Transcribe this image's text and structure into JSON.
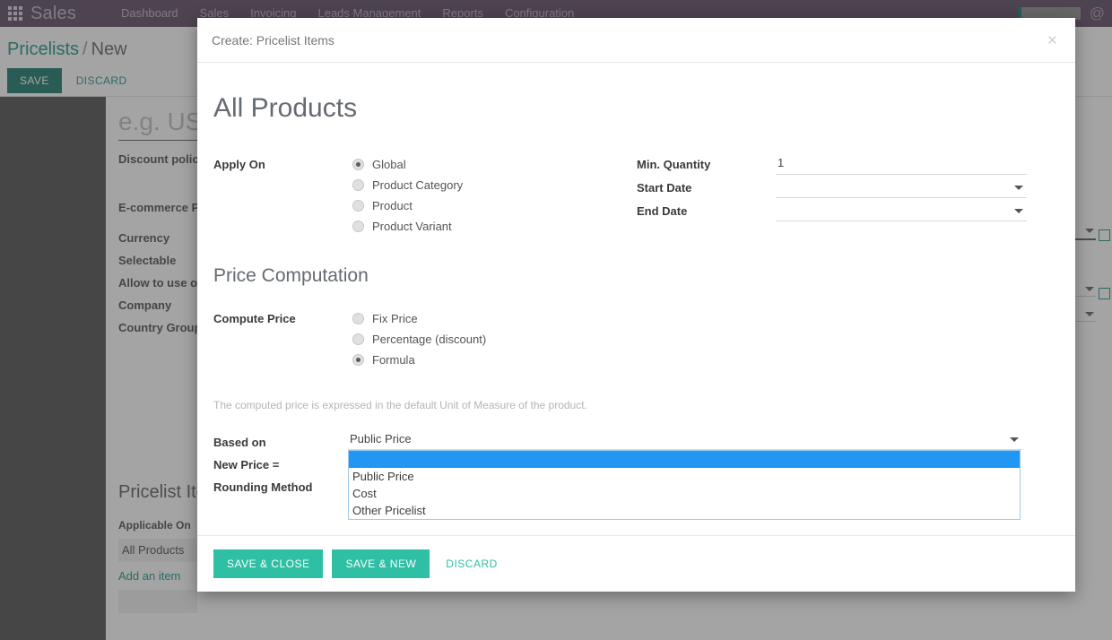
{
  "navbar": {
    "apps_icon": "apps-grid-icon",
    "brand": "Sales",
    "links": [
      "Dashboard",
      "Sales",
      "Invoicing",
      "Leads Management",
      "Reports",
      "Configuration"
    ],
    "messaging_icon": "at-sign-icon"
  },
  "background": {
    "breadcrumb": {
      "root": "Pricelists",
      "separator": "/",
      "current": "New"
    },
    "save_label": "SAVE",
    "discard_label": "DISCARD",
    "title_placeholder": "e.g. USD Retailers",
    "labels": {
      "discount_policy": "Discount policy",
      "ecommerce": "E-commerce Promotional Code",
      "currency": "Currency",
      "selectable": "Selectable",
      "allow_use_on": "Allow to use on",
      "company": "Company",
      "country_groups": "Country Groups"
    },
    "sublist": {
      "title": "Pricelist Items",
      "column_header": "Applicable On",
      "row_value": "All Products",
      "add_link": "Add an item"
    }
  },
  "modal": {
    "header_title": "Create: Pricelist Items",
    "close_icon": "close-icon",
    "record_title": "All Products",
    "apply_on": {
      "label": "Apply On",
      "options": [
        "Global",
        "Product Category",
        "Product",
        "Product Variant"
      ],
      "selected": "Global"
    },
    "min_quantity": {
      "label": "Min. Quantity",
      "value": "1"
    },
    "start_date": {
      "label": "Start Date",
      "value": ""
    },
    "end_date": {
      "label": "End Date",
      "value": ""
    },
    "price_computation": {
      "section_title": "Price Computation",
      "compute_price_label": "Compute Price",
      "options": [
        "Fix Price",
        "Percentage (discount)",
        "Formula"
      ],
      "selected": "Formula",
      "help_note": "The computed price is expressed in the default Unit of Measure of the product."
    },
    "based_on": {
      "label": "Based on",
      "value": "Public Price",
      "options": [
        "",
        "Public Price",
        "Cost",
        "Other Pricelist"
      ],
      "highlighted_option": ""
    },
    "new_price_label": "New Price =",
    "rounding_method_label": "Rounding Method",
    "footer": {
      "save_close": "SAVE & CLOSE",
      "save_new": "SAVE & NEW",
      "discard": "DISCARD"
    }
  },
  "colors": {
    "navbar_bg": "#4b3650",
    "primary_teal": "#2fbfa4",
    "save_green": "#00695c",
    "select_highlight": "#2196f3",
    "link_teal": "#00897b"
  }
}
